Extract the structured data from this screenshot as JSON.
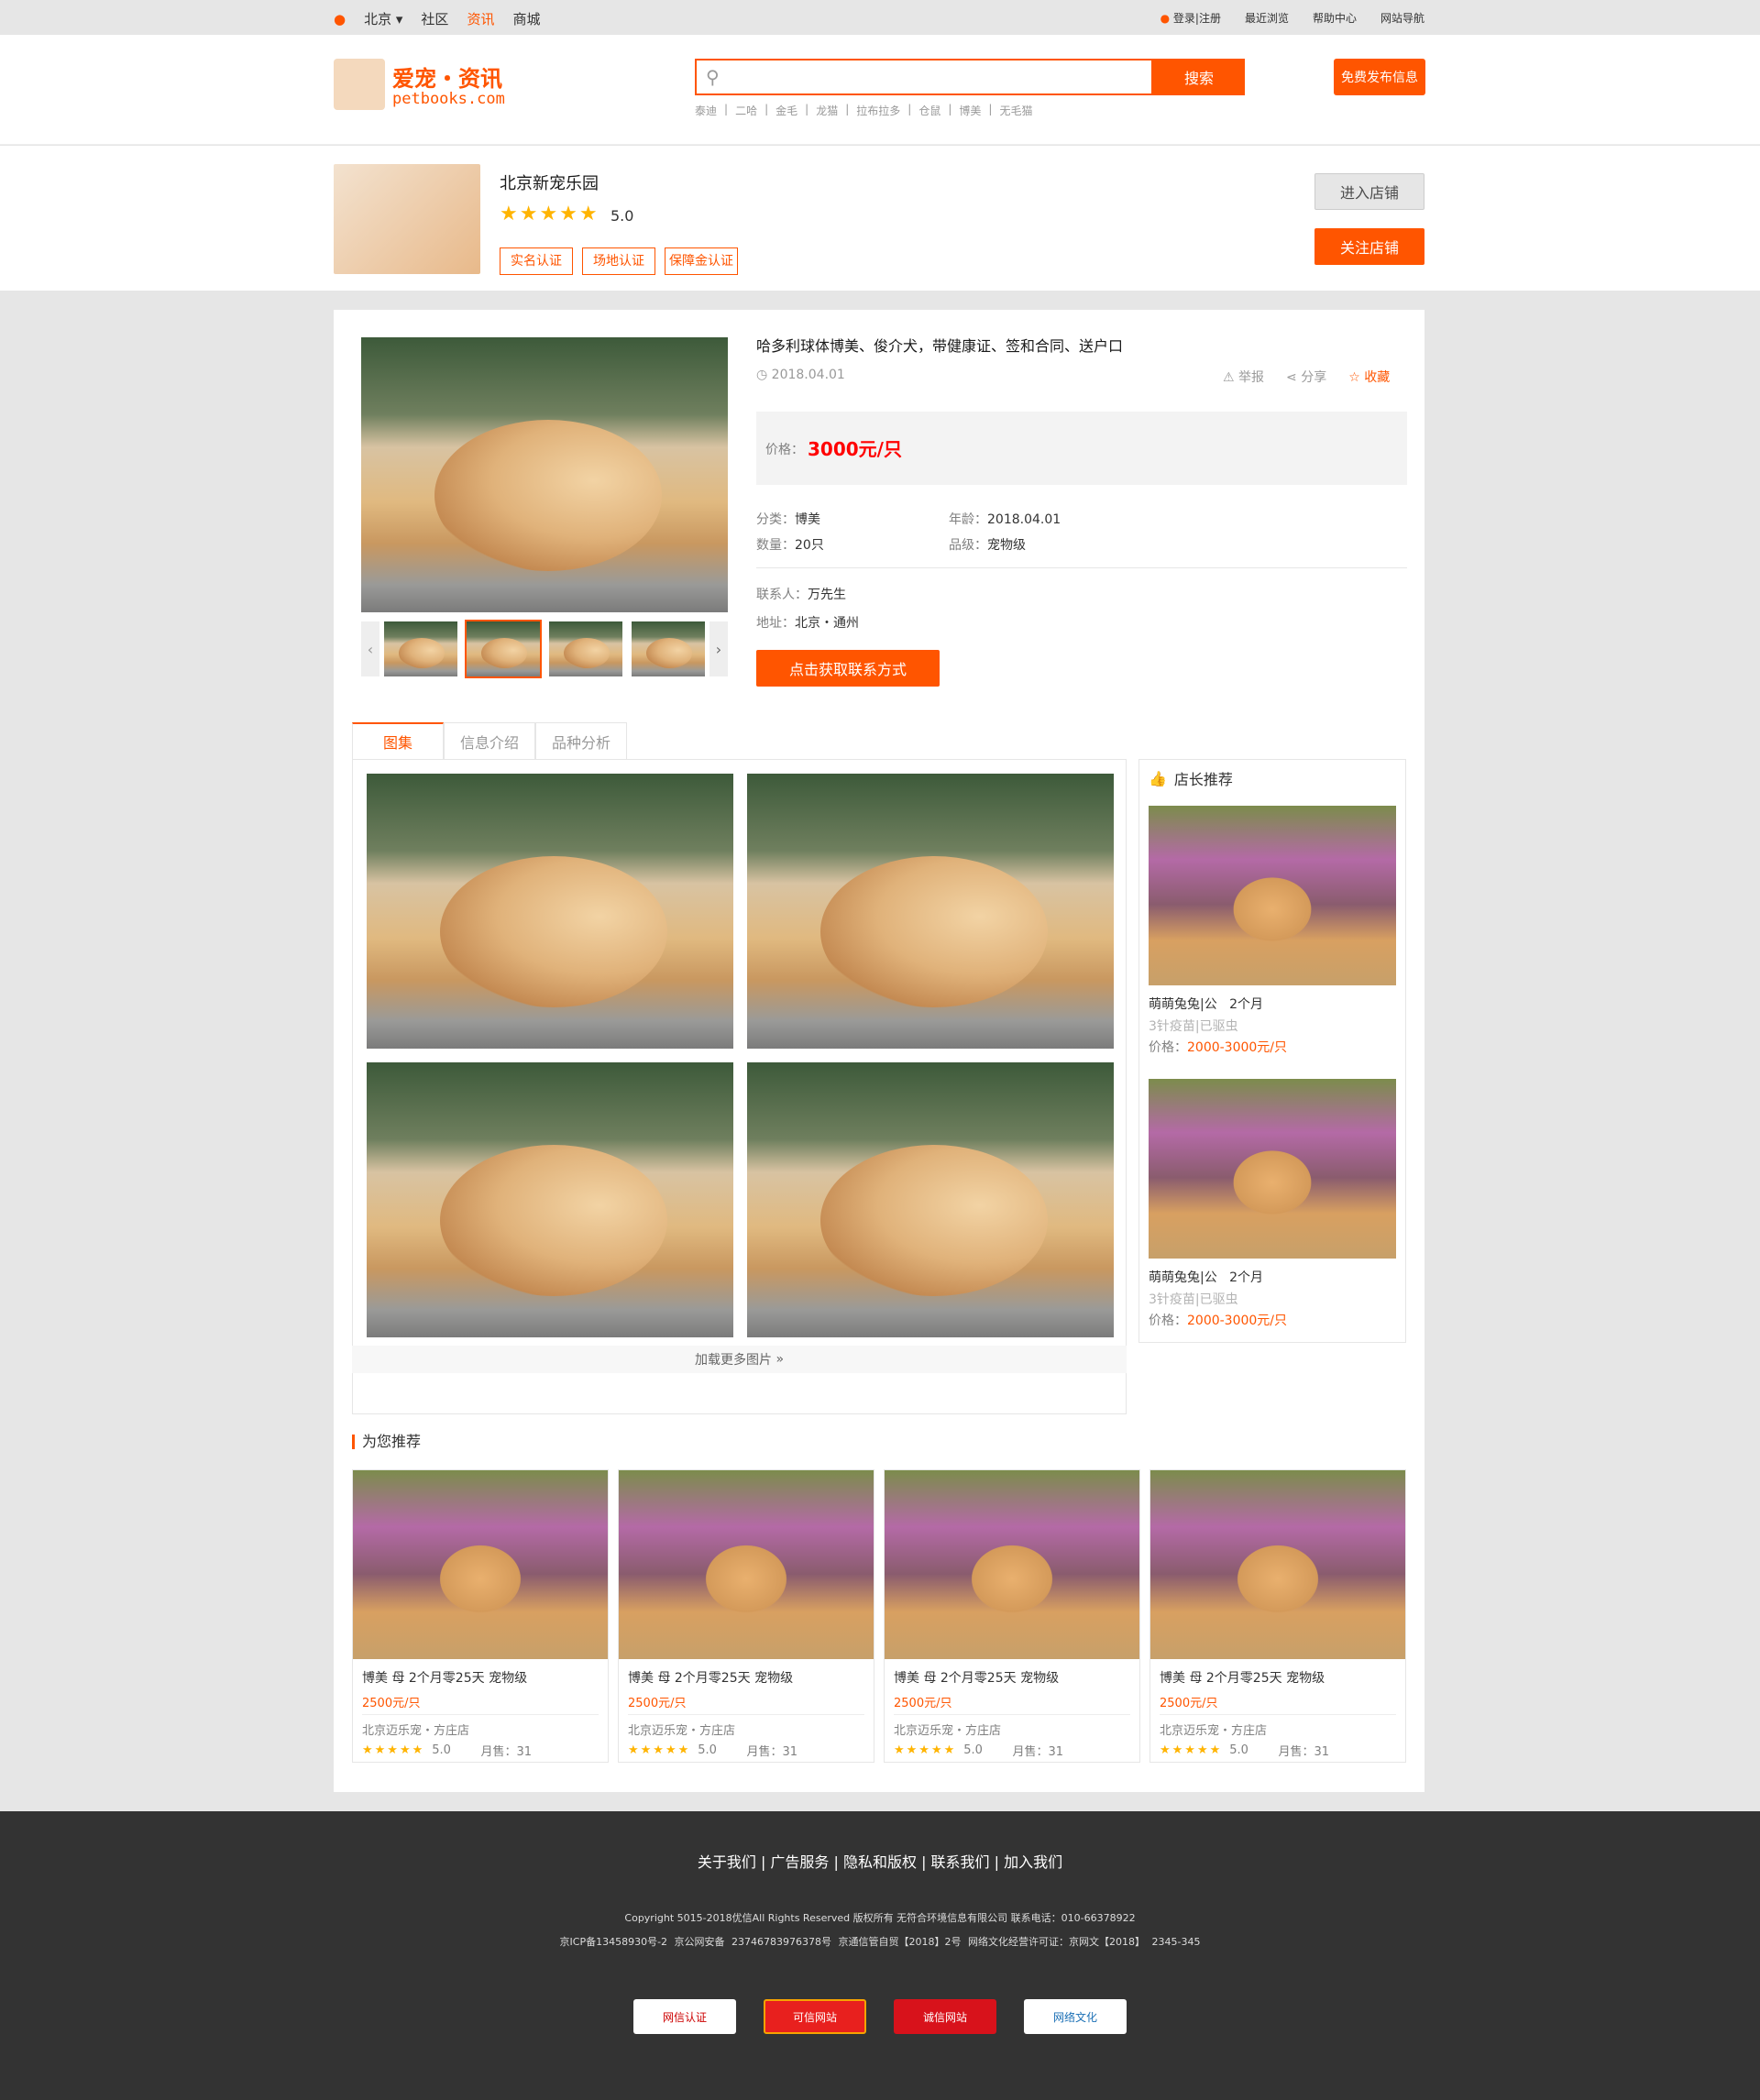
{
  "topbar": {
    "city": "北京",
    "nav": [
      "社区",
      "资讯",
      "商城"
    ],
    "right": [
      "登录|注册",
      "最近浏览",
      "帮助中心",
      "网站导航"
    ]
  },
  "header": {
    "logo_title": "爱宠・资讯",
    "logo_url": "petbooks.com",
    "search_button": "搜索",
    "hot_words": [
      "泰迪",
      "二哈",
      "金毛",
      "龙猫",
      "拉布拉多",
      "仓鼠",
      "博美",
      "无毛猫"
    ],
    "free_post": "免费发布信息"
  },
  "shop": {
    "name": "北京新宠乐园",
    "rating": "5.0",
    "tags": [
      "实名认证",
      "场地认证",
      "保障金认证"
    ],
    "enter": "进入店铺",
    "follow": "关注店铺"
  },
  "detail": {
    "title": "哈多利球体博美、俊介犬，带健康证、签和合同、送户口",
    "date": "2018.04.01",
    "actions": [
      "举报",
      "分享",
      "收藏"
    ],
    "price_label": "价格：",
    "price": "3000元/只",
    "category_label": "分类：",
    "category": "博美",
    "age_label": "年龄：",
    "age": "2018.04.01",
    "qty_label": "数量：",
    "qty": "20只",
    "grade_label": "品级：",
    "grade": "宠物级",
    "contact_label": "联系人：",
    "contact": "万先生",
    "addr_label": "地址：",
    "addr": "北京・通州",
    "contact_btn": "点击获取联系方式"
  },
  "tabs": [
    "图集",
    "信息介绍",
    "品种分析"
  ],
  "gallery": {
    "more": "加载更多图片"
  },
  "owner_rec": {
    "title": "店长推荐",
    "items": [
      {
        "name": "萌萌兔兔|公",
        "age": "2个月",
        "vacc": "3针疫苗|已驱虫",
        "price_label": "价格：",
        "price": "2000-3000元/只"
      },
      {
        "name": "萌萌兔兔|公",
        "age": "2个月",
        "vacc": "3针疫苗|已驱虫",
        "price_label": "价格：",
        "price": "2000-3000元/只"
      }
    ]
  },
  "for_you": {
    "title": "为您推荐",
    "items": [
      {
        "title": "博美  母  2个月零25天  宠物级",
        "price": "2500元/只",
        "shop": "北京迈乐宠・方庄店",
        "score": "5.0",
        "sales": "月售：31"
      },
      {
        "title": "博美  母  2个月零25天  宠物级",
        "price": "2500元/只",
        "shop": "北京迈乐宠・方庄店",
        "score": "5.0",
        "sales": "月售：31"
      },
      {
        "title": "博美  母  2个月零25天  宠物级",
        "price": "2500元/只",
        "shop": "北京迈乐宠・方庄店",
        "score": "5.0",
        "sales": "月售：31"
      },
      {
        "title": "博美  母  2个月零25天  宠物级",
        "price": "2500元/只",
        "shop": "北京迈乐宠・方庄店",
        "score": "5.0",
        "sales": "月售：31"
      }
    ]
  },
  "footer": {
    "links": "关于我们  |  广告服务  |  隐私和版权  |  联系我们  |  加入我们",
    "copyright": "Copyright  5015-2018优信All Rights Reserved 版权所有  无符合环境信息有限公司    联系电话：010-66378922",
    "licenses": "京ICP备13458930号-2      京公网安备 23746783976378号      京通信管自贸【2018】2号      网络文化经营许可证：京网文【2018】 2345-345",
    "badges": [
      "网信认证",
      "可信网站",
      "诚信网站",
      "网络文化"
    ]
  },
  "colors": {
    "accent": "#ff5500",
    "price": "#ff0000",
    "dark": "#333333",
    "bg": "#e6e6e6"
  }
}
